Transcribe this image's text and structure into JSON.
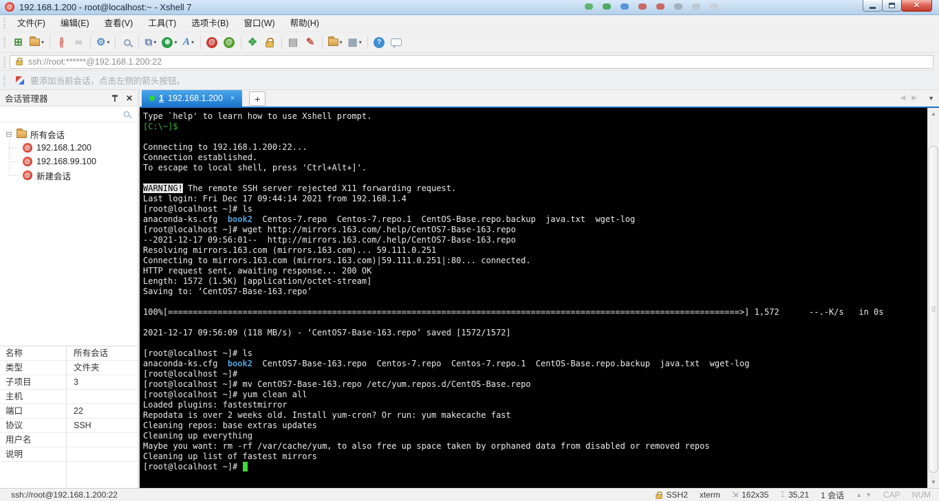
{
  "window": {
    "title": "192.168.1.200 - root@localhost:~ - Xshell 7"
  },
  "menu": {
    "items": [
      "文件(F)",
      "编辑(E)",
      "查看(V)",
      "工具(T)",
      "选项卡(B)",
      "窗口(W)",
      "帮助(H)"
    ]
  },
  "toolbar": {
    "buttons": [
      {
        "name": "new-session",
        "kind": "char",
        "glyph": "⊞",
        "color": "#3b8f3b",
        "dropdown": false,
        "sep": false
      },
      {
        "name": "open-session-folder",
        "kind": "folder",
        "dropdown": true,
        "sep": true
      },
      {
        "name": "disconnect",
        "kind": "char",
        "glyph": "∦",
        "color": "#d9776f",
        "dropdown": false,
        "sep": false
      },
      {
        "name": "reconnect",
        "kind": "char",
        "glyph": "∞",
        "color": "#b5b5b5",
        "dropdown": false,
        "sep": true
      },
      {
        "name": "session-properties",
        "kind": "char",
        "glyph": "⚙",
        "color": "#5b8fc9",
        "dropdown": true,
        "sep": true
      },
      {
        "name": "find",
        "kind": "search",
        "dropdown": false,
        "sep": true
      },
      {
        "name": "compose-pane",
        "kind": "char",
        "glyph": "⧉",
        "color": "#6f86b5",
        "dropdown": true,
        "sep": false
      },
      {
        "name": "web-tools",
        "kind": "disc",
        "glyph": "⊕",
        "color": "#2f9e4f",
        "dropdown": true,
        "sep": false
      },
      {
        "name": "font",
        "kind": "char",
        "glyph": "A",
        "color": "#3f7fd2",
        "italic": true,
        "dropdown": true,
        "sep": true
      },
      {
        "name": "xshell",
        "kind": "disc",
        "glyph": "@",
        "color": "#cc3b33",
        "dropdown": false,
        "sep": false
      },
      {
        "name": "xftp",
        "kind": "disc",
        "glyph": "@",
        "color": "#53a02f",
        "dropdown": false,
        "sep": true
      },
      {
        "name": "full-screen",
        "kind": "char",
        "glyph": "✥",
        "color": "#3fa04a",
        "dropdown": false,
        "sep": false
      },
      {
        "name": "lock-screen",
        "kind": "lock",
        "dropdown": false,
        "sep": true
      },
      {
        "name": "virtual-keyboard",
        "kind": "char",
        "glyph": "▤",
        "color": "#9a9a9a",
        "dropdown": false,
        "sep": false
      },
      {
        "name": "highlight-pen",
        "kind": "char",
        "glyph": "✎",
        "color": "#c85a4a",
        "dropdown": false,
        "sep": true
      },
      {
        "name": "new-file",
        "kind": "folder",
        "dropdown": true,
        "sep": false
      },
      {
        "name": "tile-windows",
        "kind": "char",
        "glyph": "▦",
        "color": "#8f9fae",
        "dropdown": true,
        "sep": true
      },
      {
        "name": "help",
        "kind": "disc",
        "glyph": "?",
        "color": "#3d8fd4",
        "dropdown": false,
        "sep": false
      },
      {
        "name": "feedback",
        "kind": "bubble",
        "dropdown": false,
        "sep": false
      }
    ]
  },
  "address_bar": {
    "value": "ssh://root:******@192.168.1.200:22"
  },
  "info_bar": {
    "message": "要添加当前会话，点击左侧的箭头按钮。"
  },
  "session_manager": {
    "title": "会话管理器",
    "search_placeholder": "",
    "root_label": "所有会话",
    "sessions": [
      "192.168.1.200",
      "192.168.99.100",
      "新建会话"
    ],
    "properties": [
      {
        "label": "名称",
        "value": "所有会话"
      },
      {
        "label": "类型",
        "value": "文件夹"
      },
      {
        "label": "子项目",
        "value": "3"
      },
      {
        "label": "主机",
        "value": ""
      },
      {
        "label": "端口",
        "value": "22"
      },
      {
        "label": "协议",
        "value": "SSH"
      },
      {
        "label": "用户名",
        "value": ""
      },
      {
        "label": "说明",
        "value": ""
      }
    ]
  },
  "tabs": {
    "active_index": "1",
    "active_label": "192.168.1.200"
  },
  "icons": {
    "expander": "⊟",
    "dropdown": "▾",
    "sidebar_close": "✕",
    "tab_close": "×",
    "new_tab": "+",
    "tab_prev": "◀",
    "tab_next": "▶",
    "tab_menu": "▼",
    "scroll_up": "▲",
    "scroll_down": "▼",
    "status_resize": "⇲",
    "status_caret": "⌶",
    "status_up": "▲",
    "status_down": "▼"
  },
  "terminal": {
    "palette": {
      "background": "#000000",
      "foreground": "#ebebeb",
      "green": "#3cb43c",
      "blue": "#4fa3dc",
      "cursor": "#3ddc3d"
    },
    "lines": [
      "Type `help' to learn how to use Xshell prompt.",
      [
        [
          "green",
          "[C:\\~]$ "
        ]
      ],
      "",
      "Connecting to 192.168.1.200:22...",
      "Connection established.",
      "To escape to local shell, press 'Ctrl+Alt+]'.",
      "",
      [
        [
          "inv",
          "WARNING!"
        ],
        [
          "p",
          " The remote SSH server rejected X11 forwarding request."
        ]
      ],
      "Last login: Fri Dec 17 09:44:14 2021 from 192.168.1.4",
      "[root@localhost ~]# ls",
      [
        [
          "p",
          "anaconda-ks.cfg  "
        ],
        [
          "blue",
          "book2"
        ],
        [
          "p",
          "  Centos-7.repo  Centos-7.repo.1  CentOS-Base.repo.backup  java.txt  wget-log"
        ]
      ],
      "[root@localhost ~]# wget http://mirrors.163.com/.help/CentOS7-Base-163.repo",
      "--2021-12-17 09:56:01--  http://mirrors.163.com/.help/CentOS7-Base-163.repo",
      "Resolving mirrors.163.com (mirrors.163.com)... 59.111.0.251",
      "Connecting to mirrors.163.com (mirrors.163.com)|59.111.0.251|:80... connected.",
      "HTTP request sent, awaiting response... 200 OK",
      "Length: 1572 (1.5K) [application/octet-stream]",
      "Saving to: ‘CentOS7-Base-163.repo’",
      "",
      "100%[===================================================================================================================>] 1,572      --.-K/s   in 0s",
      "",
      "2021-12-17 09:56:09 (118 MB/s) - ‘CentOS7-Base-163.repo’ saved [1572/1572]",
      "",
      "[root@localhost ~]# ls",
      [
        [
          "p",
          "anaconda-ks.cfg  "
        ],
        [
          "blue",
          "book2"
        ],
        [
          "p",
          "  CentOS7-Base-163.repo  Centos-7.repo  Centos-7.repo.1  CentOS-Base.repo.backup  java.txt  wget-log"
        ]
      ],
      "[root@localhost ~]#",
      "[root@localhost ~]# mv CentOS7-Base-163.repo /etc/yum.repos.d/CentOS-Base.repo",
      "[root@localhost ~]# yum clean all",
      "Loaded plugins: fastestmirror",
      "Repodata is over 2 weeks old. Install yum-cron? Or run: yum makecache fast",
      "Cleaning repos: base extras updates",
      "Cleaning up everything",
      "Maybe you want: rm -rf /var/cache/yum, to also free up space taken by orphaned data from disabled or removed repos",
      "Cleaning up list of fastest mirrors",
      [
        [
          "p",
          "[root@localhost ~]# "
        ],
        [
          "cursor",
          " "
        ]
      ]
    ]
  },
  "status_bar": {
    "connection": "ssh://root@192.168.1.200:22",
    "encryption": "SSH2",
    "terminal_type": "xterm",
    "terminal_size": "162x35",
    "cursor_position": "35,21",
    "session_count": "1 会话",
    "caps": "CAP",
    "num": "NUM"
  }
}
